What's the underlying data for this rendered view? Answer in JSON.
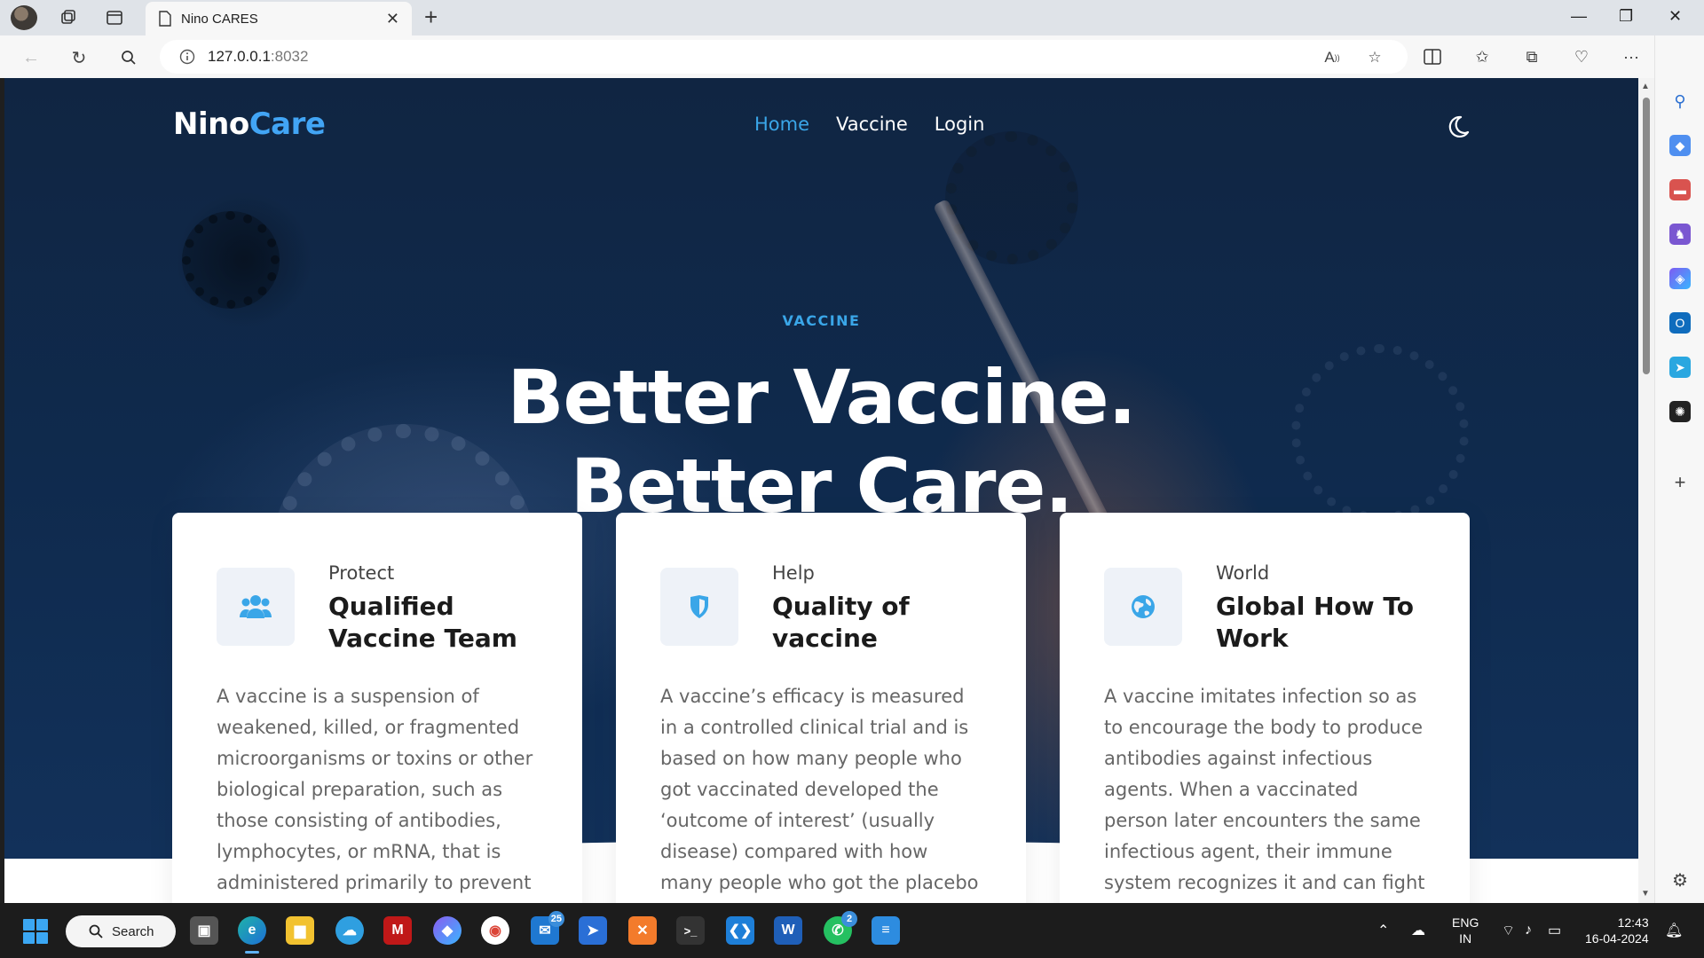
{
  "browser": {
    "tab_title": "Nino CARES",
    "url_host": "127.0.0.1",
    "url_port": ":8032"
  },
  "site": {
    "logo_part1": "Nino",
    "logo_part2": "Care",
    "nav": [
      {
        "label": "Home",
        "active": true
      },
      {
        "label": "Vaccine",
        "active": false
      },
      {
        "label": "Login",
        "active": false
      }
    ],
    "eyebrow": "VACCINE",
    "hero_line1": "Better Vaccine.",
    "hero_line2": "Better Care.",
    "accent_color": "#3aa6e8"
  },
  "cards": [
    {
      "icon": "users-icon",
      "kicker": "Protect",
      "title": "Qualified Vaccine Team",
      "text": "A vaccine is a suspension of weakened, killed, or fragmented microorganisms or toxins or other biological preparation, such as those consisting of antibodies, lymphocytes, or mRNA, that is administered primarily to prevent di"
    },
    {
      "icon": "shield-icon",
      "kicker": "Help",
      "title": "Quality of vaccine",
      "text": "A vaccine’s efficacy is measured in a controlled clinical trial and is based on how many people who got vaccinated developed the ‘outcome of interest’ (usually disease) compared with how many people who got the placebo (dummy vaccine) developed the"
    },
    {
      "icon": "globe-icon",
      "kicker": "World",
      "title": "Global How To Work",
      "text": "A vaccine imitates infection so as to encourage the body to produce antibodies against infectious agents. When a vaccinated person later encounters the same infectious agent, their immune system recognizes it and can fight it off"
    }
  ],
  "taskbar": {
    "search_label": "Search",
    "mail_badge": "25",
    "whatsapp_badge": "2",
    "lang_line1": "ENG",
    "lang_line2": "IN",
    "time": "12:43",
    "date": "16-04-2024"
  }
}
